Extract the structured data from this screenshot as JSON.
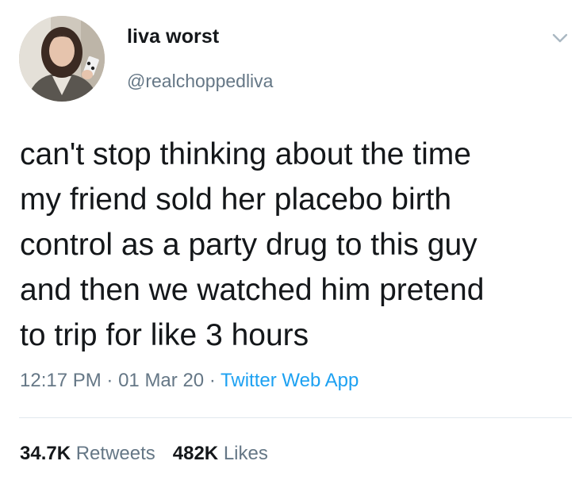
{
  "user": {
    "display_name": "liva worst",
    "handle": "@realchoppedliva",
    "avatar_icon": "profile-photo"
  },
  "tweet": {
    "lines": [
      "can't stop thinking about the time",
      "my friend sold her placebo birth",
      "control as a party drug to this guy",
      "and then we watched him pretend",
      "to trip for like 3 hours"
    ],
    "time": "12:17 PM",
    "date": "01 Mar 20",
    "separator": "·",
    "source": "Twitter Web App"
  },
  "stats": {
    "retweets_count": "34.7K",
    "retweets_label": "Retweets",
    "likes_count": "482K",
    "likes_label": "Likes"
  },
  "menu": {
    "icon": "chevron-down-icon"
  },
  "colors": {
    "text": "#14171a",
    "secondary": "#657786",
    "link": "#1da1f2",
    "divider": "#e1e8ed"
  }
}
